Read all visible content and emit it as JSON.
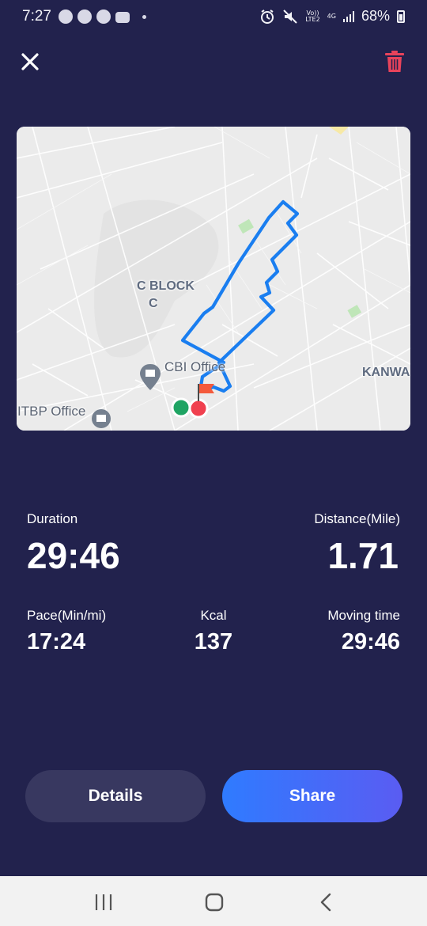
{
  "status_bar": {
    "time": "7:27",
    "network_top": "Vo))",
    "network_bottom": "LTE2",
    "network_type": "4G",
    "battery": "68%",
    "left_icons": [
      "spotify-icon",
      "whatsapp-icon",
      "app-grid-icon",
      "youtube-icon",
      "dot-icon"
    ],
    "right_icons": [
      "alarm-icon",
      "mute-icon",
      "signal-icon",
      "battery-icon"
    ]
  },
  "header": {
    "close_icon": "close-icon",
    "delete_icon": "trash-icon",
    "delete_color": "#e8435b"
  },
  "map": {
    "labels": {
      "c_block_line1": "C BLOCK",
      "c_block_line2": "C",
      "cbi_office": "CBI Office",
      "kanwa": "KANWA",
      "itbp_office": "ITBP Office"
    },
    "route_color": "#1a7ef0",
    "start_marker_color": "#1fa463",
    "end_marker_color": "#f0404f",
    "flag_color": "#f45a3c"
  },
  "stats": {
    "duration_label": "Duration",
    "duration_value": "29:46",
    "distance_label": "Distance(Mile)",
    "distance_value": "1.71",
    "pace_label": "Pace(Min/mi)",
    "pace_value": "17:24",
    "kcal_label": "Kcal",
    "kcal_value": "137",
    "moving_label": "Moving time",
    "moving_value": "29:46"
  },
  "actions": {
    "details_label": "Details",
    "share_label": "Share"
  },
  "nav_bar": {
    "recents_icon": "recents-icon",
    "home_icon": "home-icon",
    "back_icon": "back-icon"
  }
}
